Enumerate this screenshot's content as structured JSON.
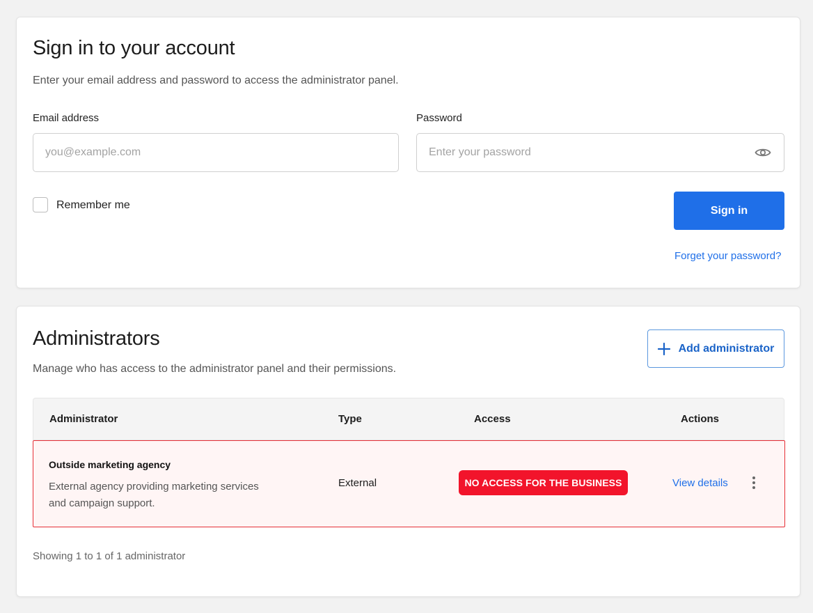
{
  "signin": {
    "title": "Sign in to your account",
    "subtitle": "Enter your email address and password to access the administrator panel.",
    "email_label": "Email address",
    "email_placeholder": "you@example.com",
    "email_value": "",
    "password_label": "Password",
    "password_placeholder": "Enter your password",
    "password_value": "",
    "remember_label": "Remember me",
    "remember_checked": false,
    "submit_label": "Sign in",
    "forgot_label": "Forget your password?"
  },
  "admins": {
    "title": "Administrators",
    "subtitle": "Manage who has access to the administrator panel and their permissions.",
    "add_label": "Add administrator",
    "columns": [
      "Administrator",
      "Type",
      "Access",
      "Actions"
    ],
    "rows": [
      {
        "name": "Outside marketing agency",
        "description": "External agency providing marketing services and campaign support.",
        "type": "External",
        "access": "NO ACCESS FOR THE BUSINESS",
        "action": "View details"
      }
    ],
    "footer": "Showing 1 to 1 of 1 administrator"
  },
  "colors": {
    "primary": "#1f6fe8",
    "danger": "#f2142b",
    "danger_row_bg": "#fff5f5",
    "danger_border": "#e62e36"
  },
  "icons": {
    "password_toggle": "eye-icon",
    "add": "plus-icon",
    "row_menu": "kebab-menu-icon"
  }
}
